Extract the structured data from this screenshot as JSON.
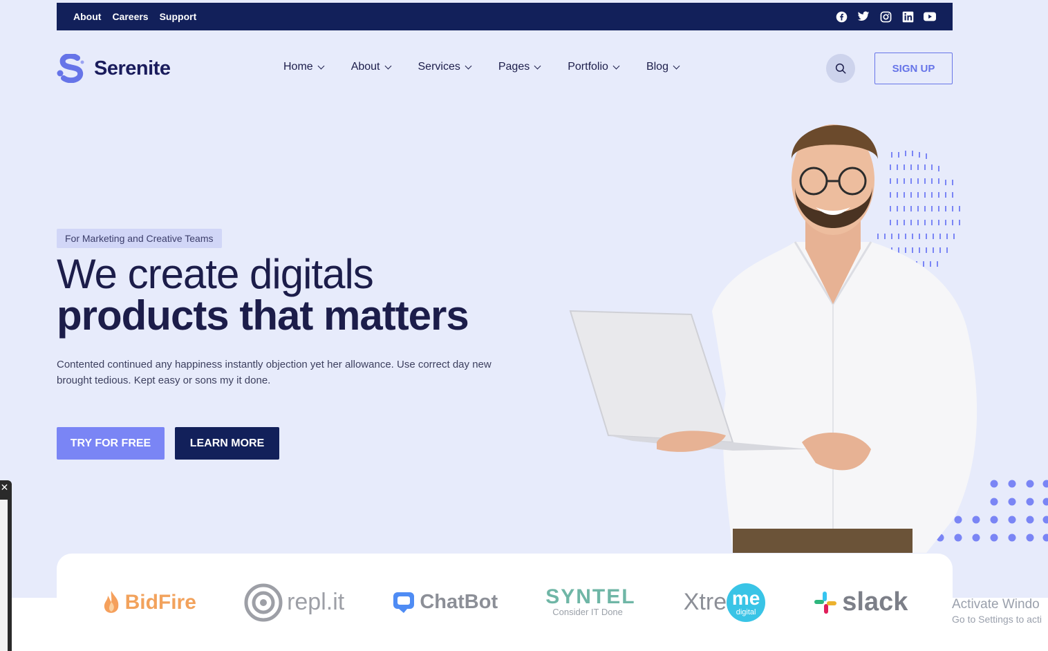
{
  "topbar": {
    "links": [
      "About",
      "Careers",
      "Support"
    ],
    "social_icons": [
      "facebook-icon",
      "twitter-icon",
      "instagram-icon",
      "linkedin-icon",
      "youtube-icon"
    ]
  },
  "brand": {
    "name": "Serenite",
    "color": "#6674e8"
  },
  "nav": {
    "items": [
      {
        "label": "Home"
      },
      {
        "label": "About"
      },
      {
        "label": "Services"
      },
      {
        "label": "Pages"
      },
      {
        "label": "Portfolio"
      },
      {
        "label": "Blog"
      }
    ],
    "signup_label": "SIGN UP"
  },
  "hero": {
    "tag": "For Marketing and Creative Teams",
    "title_line1": "We create digitals",
    "title_line2": "products that matters",
    "description": "Contented continued any happiness instantly objection yet her allowance. Use correct day new brought tedious. Kept easy or sons my it done.",
    "primary_cta": "TRY FOR FREE",
    "secondary_cta": "LEARN MORE"
  },
  "brands": [
    {
      "name": "BidFire",
      "icon": "flame-icon"
    },
    {
      "name": "repl.it",
      "icon": "repl-icon"
    },
    {
      "name": "ChatBot",
      "icon": "chat-icon"
    },
    {
      "name": "SYNTEL",
      "tagline": "Consider IT Done",
      "icon": "syntel-icon"
    },
    {
      "name": "Xtre",
      "accent": "me",
      "sub": "digital",
      "icon": "xtreme-icon"
    },
    {
      "name": "slack",
      "icon": "slack-icon"
    }
  ],
  "watermark": {
    "line1": "Activate Windo",
    "line2": "Go to Settings to acti"
  },
  "colors": {
    "navy": "#12205a",
    "accent": "#7a85f5",
    "background": "#e7ebfb"
  }
}
